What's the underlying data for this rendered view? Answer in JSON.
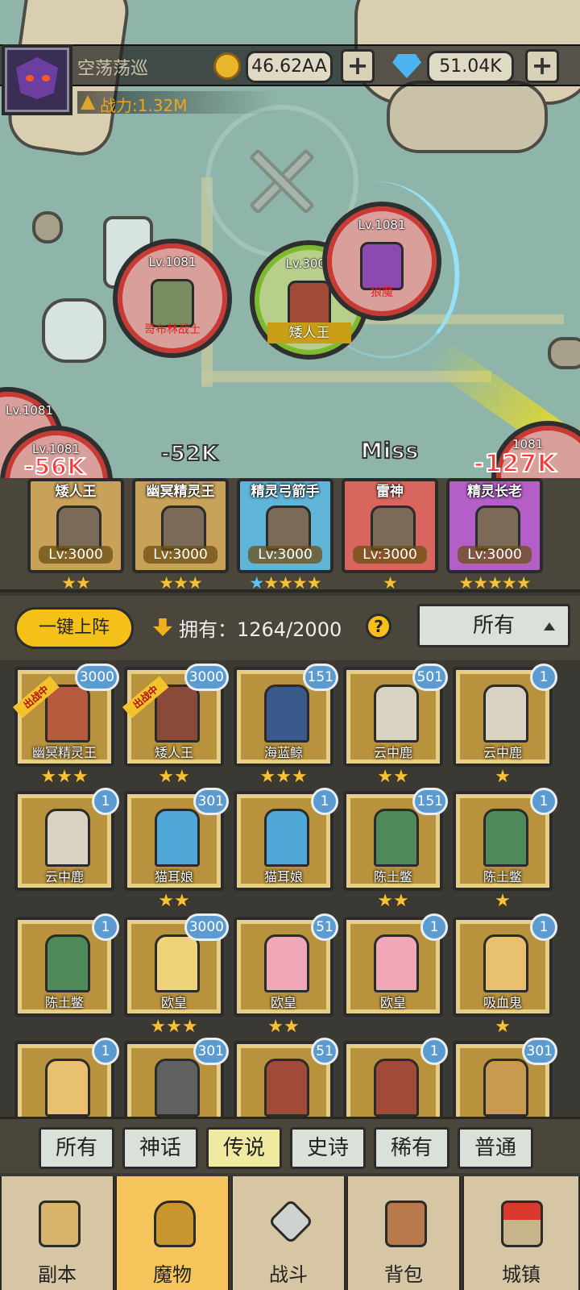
{
  "player": {
    "name": "空荡荡巡",
    "power": "战力:1.32M",
    "gold": "46.62AA",
    "gems": "51.04K",
    "add_gold": "+",
    "add_gems": "+"
  },
  "battle": {
    "units": [
      {
        "level": "Lv.1081",
        "name": "哥布林战士"
      },
      {
        "level": "Lv.3000",
        "name": "矮人王"
      },
      {
        "level": "Lv.1081",
        "name": "狼魔"
      },
      {
        "level": "Lv.1081",
        "name": ""
      },
      {
        "level": "Lv.1081",
        "name": ""
      },
      {
        "level": "1081",
        "name": ""
      }
    ],
    "damage": [
      "-52K",
      "Miss",
      "-127K",
      "-56K"
    ]
  },
  "formation": [
    {
      "name": "矮人王",
      "level": "Lv:3000",
      "stars": "★★",
      "blue_stars": "",
      "color": "#c8a15a"
    },
    {
      "name": "幽冥精灵王",
      "level": "Lv:3000",
      "stars": "★★★",
      "blue_stars": "",
      "color": "#c8a15a"
    },
    {
      "name": "精灵弓箭手",
      "level": "Lv:3000",
      "stars": "★★★★",
      "blue_stars": "★",
      "color": "#5fb4d8"
    },
    {
      "name": "雷神",
      "level": "Lv:3000",
      "stars": "★",
      "blue_stars": "",
      "color": "#d8665e"
    },
    {
      "name": "精灵长老",
      "level": "Lv:3000",
      "stars": "★★★★★",
      "blue_stars": "",
      "color": "#b45ec8"
    }
  ],
  "controls": {
    "auto_deploy": "一键上阵",
    "owned": "拥有：1264/2000",
    "help": "?",
    "filter": "所有"
  },
  "monsters": [
    {
      "name": "幽冥精灵王",
      "level": "3000",
      "stars": "★★★",
      "deployed": "出战中"
    },
    {
      "name": "矮人王",
      "level": "3000",
      "stars": "★★",
      "deployed": "出战中"
    },
    {
      "name": "海蓝鲸",
      "level": "151",
      "stars": "★★★",
      "deployed": ""
    },
    {
      "name": "云中鹿",
      "level": "501",
      "stars": "★★",
      "deployed": ""
    },
    {
      "name": "云中鹿",
      "level": "1",
      "stars": "★",
      "deployed": ""
    },
    {
      "name": "云中鹿",
      "level": "1",
      "stars": "",
      "deployed": ""
    },
    {
      "name": "猫耳娘",
      "level": "301",
      "stars": "★★",
      "deployed": ""
    },
    {
      "name": "猫耳娘",
      "level": "1",
      "stars": "",
      "deployed": ""
    },
    {
      "name": "陈土鳖",
      "level": "151",
      "stars": "★★",
      "deployed": ""
    },
    {
      "name": "陈土鳖",
      "level": "1",
      "stars": "★",
      "deployed": ""
    },
    {
      "name": "陈土鳖",
      "level": "1",
      "stars": "",
      "deployed": ""
    },
    {
      "name": "欧皇",
      "level": "3000",
      "stars": "★★★",
      "deployed": ""
    },
    {
      "name": "欧皇",
      "level": "51",
      "stars": "★★",
      "deployed": ""
    },
    {
      "name": "欧皇",
      "level": "1",
      "stars": "",
      "deployed": ""
    },
    {
      "name": "吸血鬼",
      "level": "1",
      "stars": "★",
      "deployed": ""
    },
    {
      "name": "",
      "level": "1",
      "stars": "",
      "deployed": ""
    },
    {
      "name": "",
      "level": "301",
      "stars": "",
      "deployed": ""
    },
    {
      "name": "",
      "level": "51",
      "stars": "",
      "deployed": ""
    },
    {
      "name": "",
      "level": "1",
      "stars": "",
      "deployed": ""
    },
    {
      "name": "",
      "level": "301",
      "stars": "",
      "deployed": ""
    }
  ],
  "rarity_tabs": [
    "所有",
    "神话",
    "传说",
    "史诗",
    "稀有",
    "普通"
  ],
  "nav": [
    "副本",
    "魔物",
    "战斗",
    "背包",
    "城镇"
  ],
  "colors": {
    "gold_accent": "#f5c018",
    "active_nav": "#f5c45a",
    "badge": "#5b9bd0"
  }
}
